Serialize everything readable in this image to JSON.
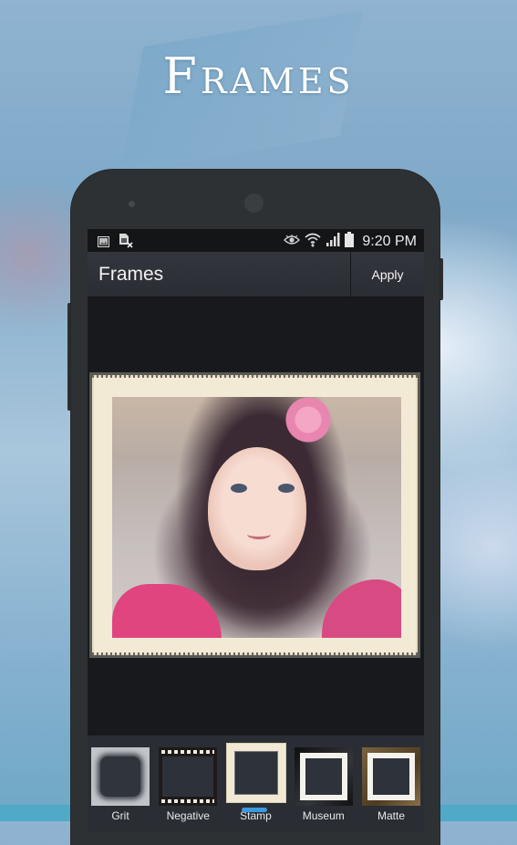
{
  "hero": {
    "title": "Frames"
  },
  "status_bar": {
    "left_icons": [
      "image-notification-icon",
      "sim-card-error-icon"
    ],
    "right_icons": [
      "eye-smart-stay-icon",
      "wifi-icon",
      "signal-icon",
      "battery-icon"
    ],
    "time": "9:20 PM"
  },
  "action_bar": {
    "title": "Frames",
    "apply_label": "Apply"
  },
  "frames": [
    {
      "label": "Grit",
      "selected": false
    },
    {
      "label": "Negative",
      "selected": false
    },
    {
      "label": "Stamp",
      "selected": true
    },
    {
      "label": "Museum",
      "selected": false
    },
    {
      "label": "Matte",
      "selected": false
    }
  ],
  "colors": {
    "accent": "#3a9ae0",
    "action_bar": "#2e3238",
    "screen_bg": "#18191d",
    "stamp_paper": "#f3ead6"
  }
}
